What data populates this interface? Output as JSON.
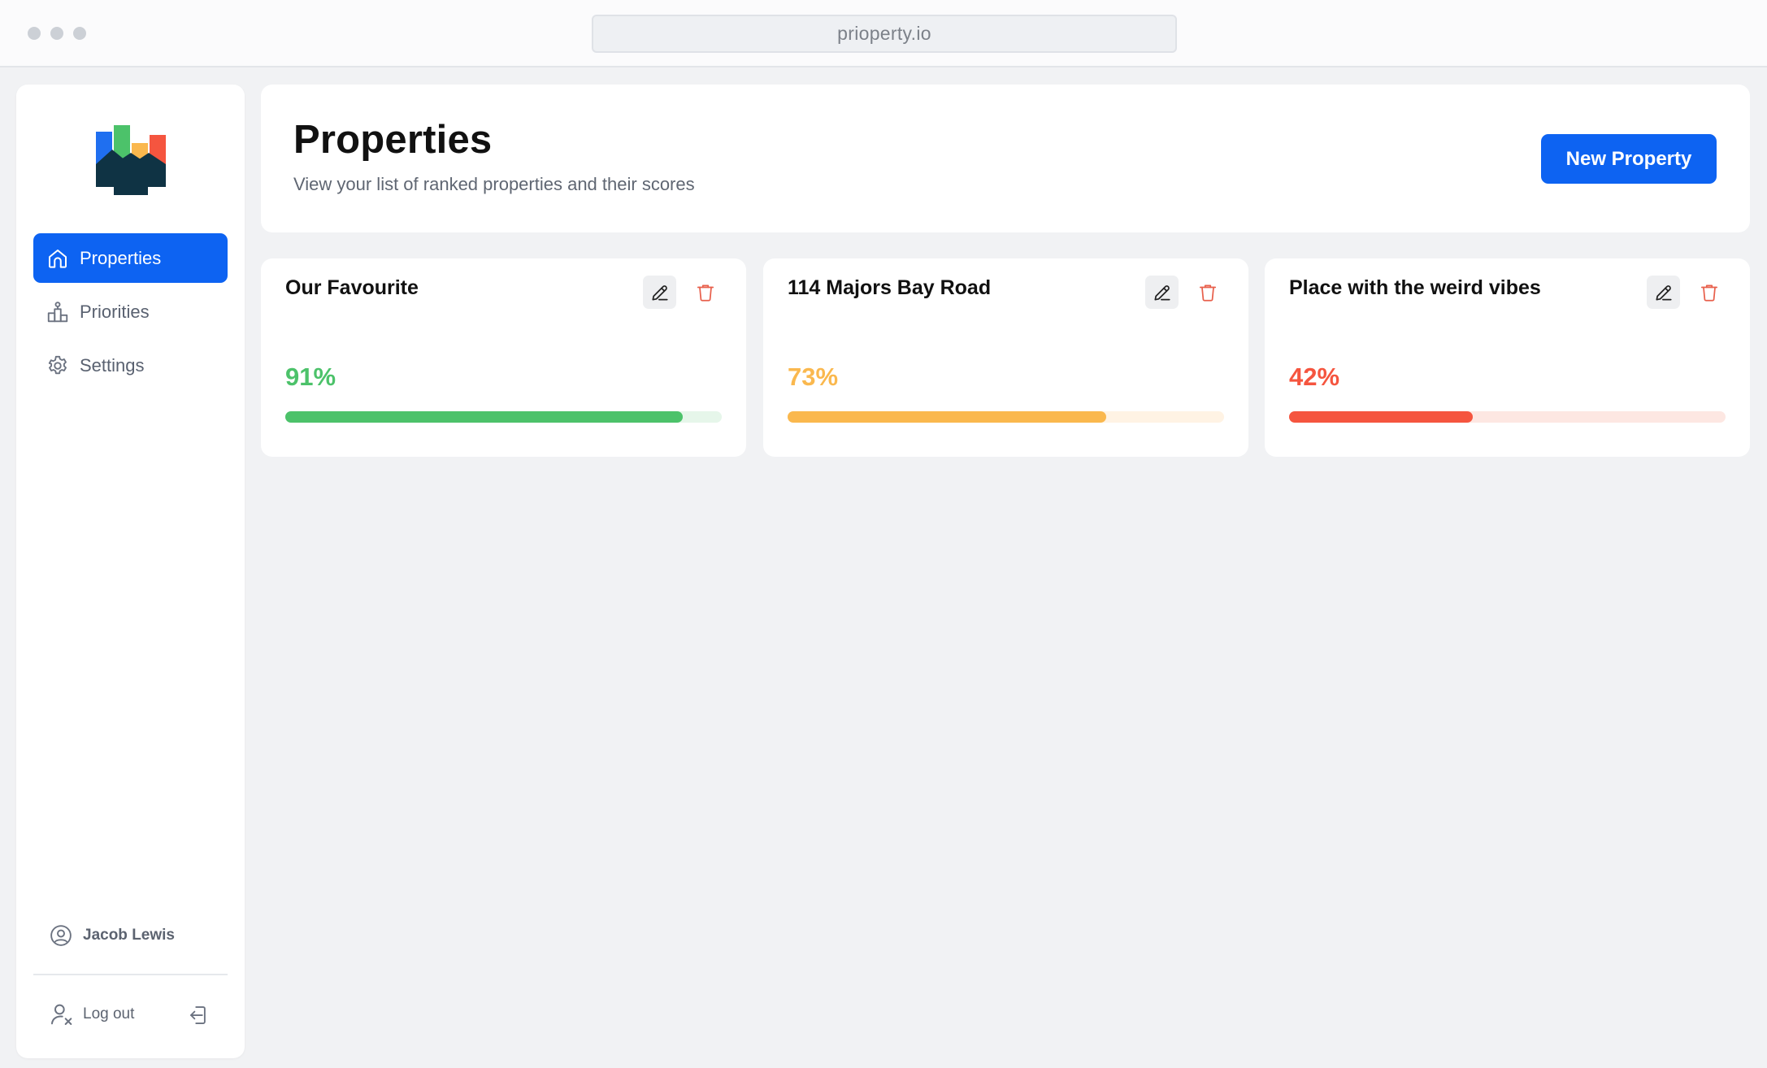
{
  "browser": {
    "url": "prioperty.io"
  },
  "sidebar": {
    "items": [
      {
        "label": "Properties",
        "icon": "home-icon",
        "active": true
      },
      {
        "label": "Priorities",
        "icon": "podium-icon",
        "active": false
      },
      {
        "label": "Settings",
        "icon": "gear-icon",
        "active": false
      }
    ],
    "user_name": "Jacob Lewis",
    "logout_label": "Log out"
  },
  "header": {
    "title": "Properties",
    "subtitle": "View your list of ranked properties and their scores",
    "new_button_label": "New Property"
  },
  "properties": [
    {
      "name": "Our Favourite",
      "score_label": "91%",
      "score": 0.91,
      "color": "#4cc26a",
      "track_color": "#e6f6ea"
    },
    {
      "name": "114 Majors Bay Road",
      "score_label": "73%",
      "score": 0.73,
      "color": "#fab84e",
      "track_color": "#fff3e4"
    },
    {
      "name": "Place with the weird vibes",
      "score_label": "42%",
      "score": 0.42,
      "color": "#f5553f",
      "track_color": "#fde7e2"
    }
  ],
  "colors": {
    "accent": "#0d63f2",
    "delete": "#e8604c"
  }
}
